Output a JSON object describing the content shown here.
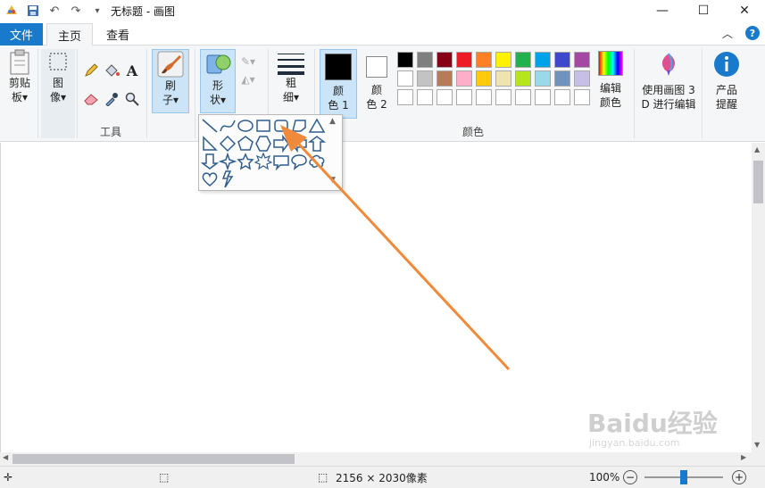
{
  "window": {
    "title": "无标题 - 画图",
    "minimize": "—",
    "maximize": "☐",
    "close": "✕"
  },
  "tabs": {
    "file": "文件",
    "home": "主页",
    "view": "查看"
  },
  "ribbon": {
    "clipboard": "剪贴\n板▾",
    "image": "图\n像▾",
    "tools_label": "工具",
    "brushes": "刷\n子▾",
    "shapes": "形\n状▾",
    "size": "粗\n细▾",
    "color1": "颜\n色 1",
    "color2": "颜\n色 2",
    "colors_label": "颜色",
    "edit_colors": "编辑\n颜色",
    "paint3d": "使用画图 3\nD 进行编辑",
    "product_alert": "产品\n提醒"
  },
  "palette": {
    "row1": [
      "#000000",
      "#7f7f7f",
      "#880015",
      "#ed1c24",
      "#ff7f27",
      "#fff200",
      "#22b14c",
      "#00a2e8",
      "#3f48cc",
      "#a349a4"
    ],
    "row2": [
      "#ffffff",
      "#c3c3c3",
      "#b97a57",
      "#ffaec9",
      "#ffc90e",
      "#efe4b0",
      "#b5e61d",
      "#99d9ea",
      "#7092be",
      "#c8bfe7"
    ],
    "row3": [
      "#ffffff",
      "#ffffff",
      "#ffffff",
      "#ffffff",
      "#ffffff",
      "#ffffff",
      "#ffffff",
      "#ffffff",
      "#ffffff",
      "#ffffff"
    ],
    "color1": "#000000",
    "color2": "#ffffff"
  },
  "status": {
    "dimensions": "2156 × 2030像素",
    "zoom": "100%"
  },
  "watermark": {
    "brand": "Baidu经验",
    "url": "jingyan.baidu.com"
  },
  "annotation": {
    "arrow_color": "#f08a3a"
  }
}
